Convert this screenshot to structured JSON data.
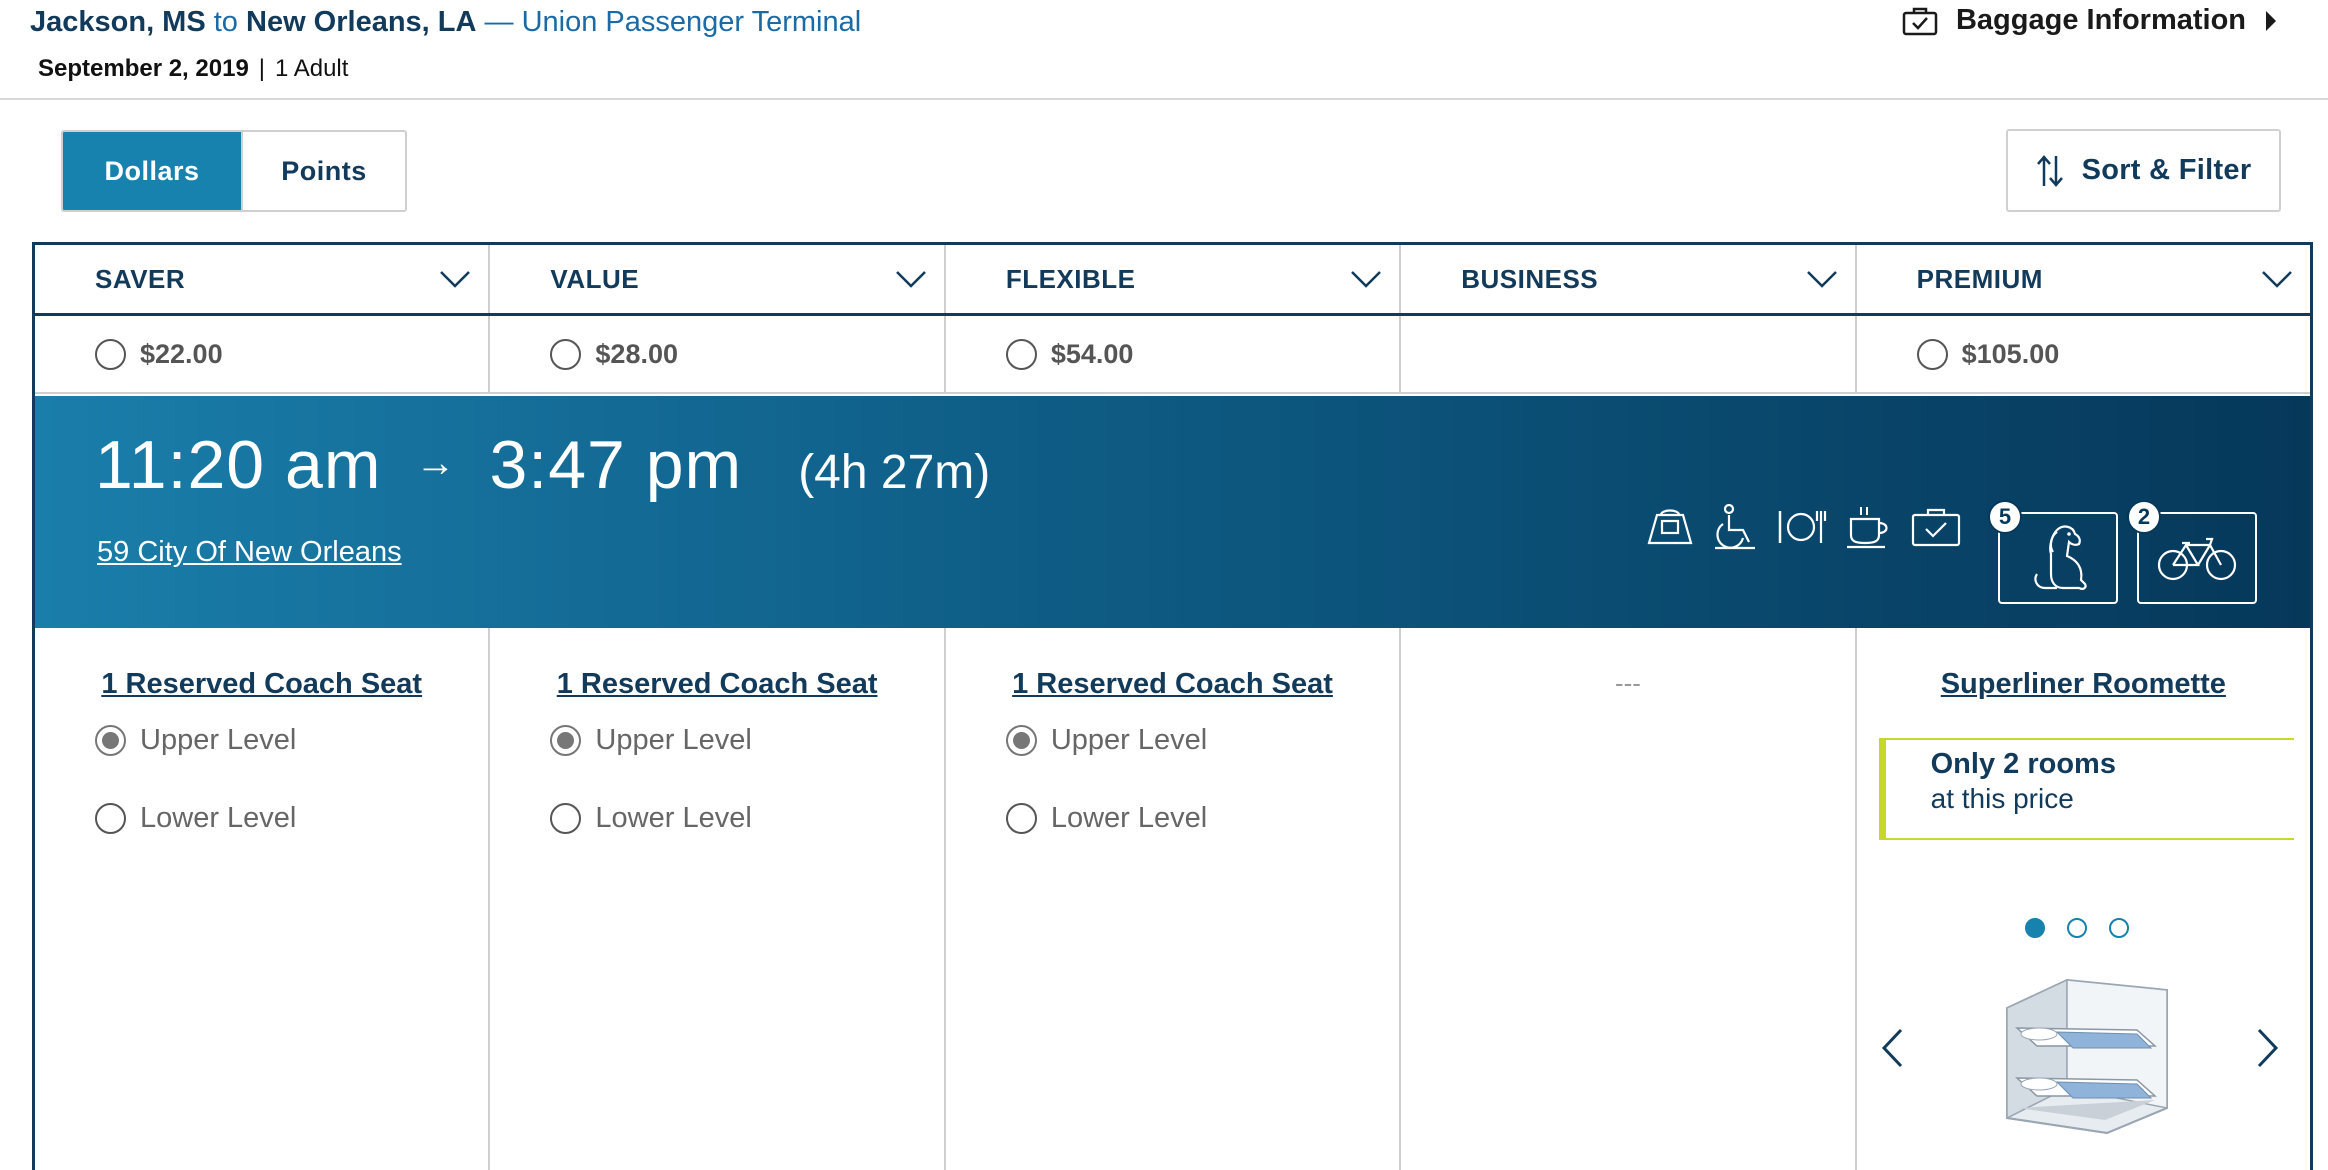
{
  "trip": {
    "origin": "Jackson, MS",
    "connector": "to",
    "destination": "New Orleans, LA",
    "station": "— Union Passenger Terminal",
    "date": "September 2, 2019",
    "separator": "|",
    "passengers": "1 Adult"
  },
  "baggage": {
    "label": "Baggage Information",
    "icon": "suitcase-icon"
  },
  "currency_toggle": {
    "options": [
      "Dollars",
      "Points"
    ],
    "selected": "Dollars"
  },
  "sort_filter": {
    "label": "Sort & Filter",
    "icon": "sort-arrows-icon"
  },
  "fare_tiers": [
    {
      "name": "SAVER",
      "price": "$22.00"
    },
    {
      "name": "VALUE",
      "price": "$28.00"
    },
    {
      "name": "FLEXIBLE",
      "price": "$54.00"
    },
    {
      "name": "BUSINESS",
      "price": ""
    },
    {
      "name": "PREMIUM",
      "price": "$105.00"
    }
  ],
  "train": {
    "depart": "11:20 am",
    "arrow": "→",
    "arrive": "3:47 pm",
    "duration": "(4h 27m)",
    "name": "59 City Of New Orleans",
    "amenities": [
      "bag-icon",
      "wheelchair-icon",
      "dining-icon",
      "cafe-icon",
      "checked-baggage-icon"
    ],
    "pet_count": "5",
    "bike_count": "2"
  },
  "accommodations": [
    {
      "title": "1 Reserved Coach Seat",
      "levels": [
        "Upper Level",
        "Lower Level"
      ],
      "selected": "Upper Level"
    },
    {
      "title": "1 Reserved Coach Seat",
      "levels": [
        "Upper Level",
        "Lower Level"
      ],
      "selected": "Upper Level"
    },
    {
      "title": "1 Reserved Coach Seat",
      "levels": [
        "Upper Level",
        "Lower Level"
      ],
      "selected": "Upper Level"
    },
    {
      "title": "---"
    },
    {
      "title": "Superliner Roomette",
      "notice_line1": "Only 2 rooms",
      "notice_line2": "at this price",
      "carousel_pages": 3,
      "carousel_active": 1
    }
  ],
  "colors": {
    "brand_blue": "#1682ad",
    "navy": "#123a5a",
    "notice_green": "#c5d82b"
  }
}
